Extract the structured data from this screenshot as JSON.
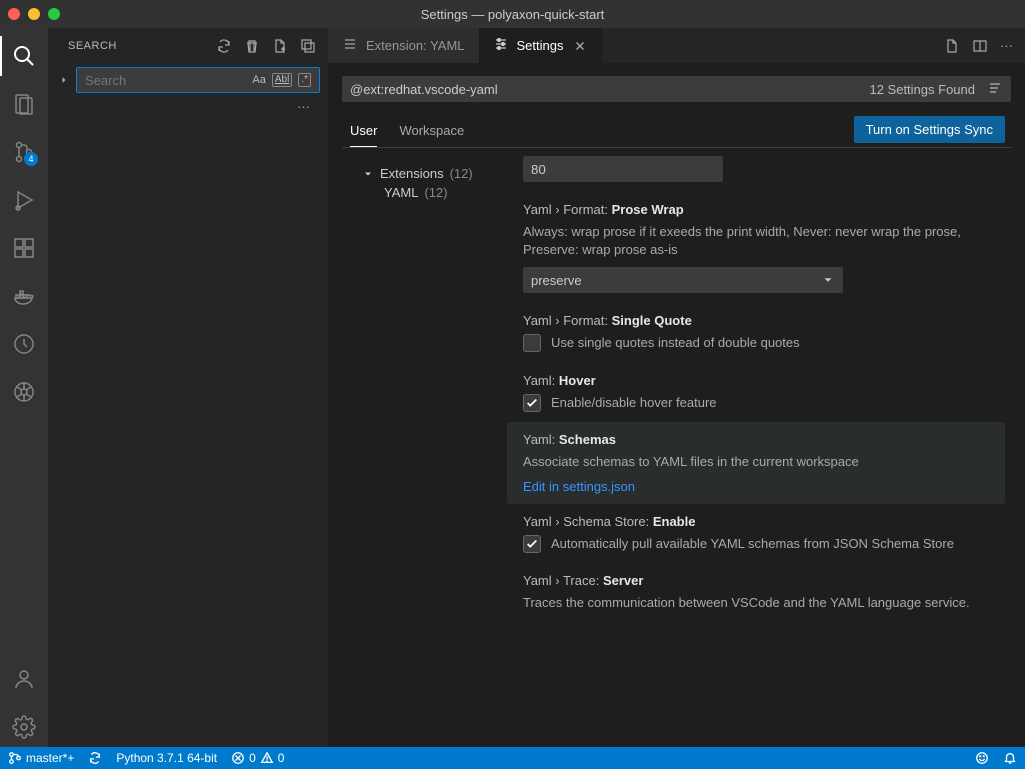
{
  "titlebar": {
    "title": "Settings — polyaxon-quick-start"
  },
  "activity": {
    "badge_scm": "4"
  },
  "sidebar": {
    "title": "SEARCH",
    "search_placeholder": "Search",
    "opt_case": "Aa",
    "opt_word": "Abl"
  },
  "tabs": {
    "ext": "Extension: YAML",
    "settings": "Settings"
  },
  "settings_filter": {
    "value": "@ext:redhat.vscode-yaml",
    "found": "12 Settings Found"
  },
  "scope": {
    "user": "User",
    "workspace": "Workspace",
    "sync": "Turn on Settings Sync"
  },
  "toc": {
    "extensions": "Extensions",
    "extensions_count": "(12)",
    "yaml": "YAML",
    "yaml_count": "(12)"
  },
  "settings": {
    "printwidth_value": "80",
    "prosewrap_crumb": "Yaml › Format:",
    "prosewrap_name": "Prose Wrap",
    "prosewrap_desc": "Always: wrap prose if it exeeds the print width, Never: never wrap the prose, Preserve: wrap prose as-is",
    "prosewrap_value": "preserve",
    "singlequote_crumb": "Yaml › Format:",
    "singlequote_name": "Single Quote",
    "singlequote_desc": "Use single quotes instead of double quotes",
    "hover_crumb": "Yaml:",
    "hover_name": "Hover",
    "hover_desc": "Enable/disable hover feature",
    "schemas_crumb": "Yaml:",
    "schemas_name": "Schemas",
    "schemas_desc": "Associate schemas to YAML files in the current workspace",
    "schemas_link": "Edit in settings.json",
    "schemastore_crumb": "Yaml › Schema Store:",
    "schemastore_name": "Enable",
    "schemastore_desc": "Automatically pull available YAML schemas from JSON Schema Store",
    "trace_crumb": "Yaml › Trace:",
    "trace_name": "Server",
    "trace_desc": "Traces the communication between VSCode and the YAML language service."
  },
  "status": {
    "branch": "master*+",
    "python": "Python 3.7.1 64-bit",
    "errors": "0",
    "warnings": "0"
  }
}
